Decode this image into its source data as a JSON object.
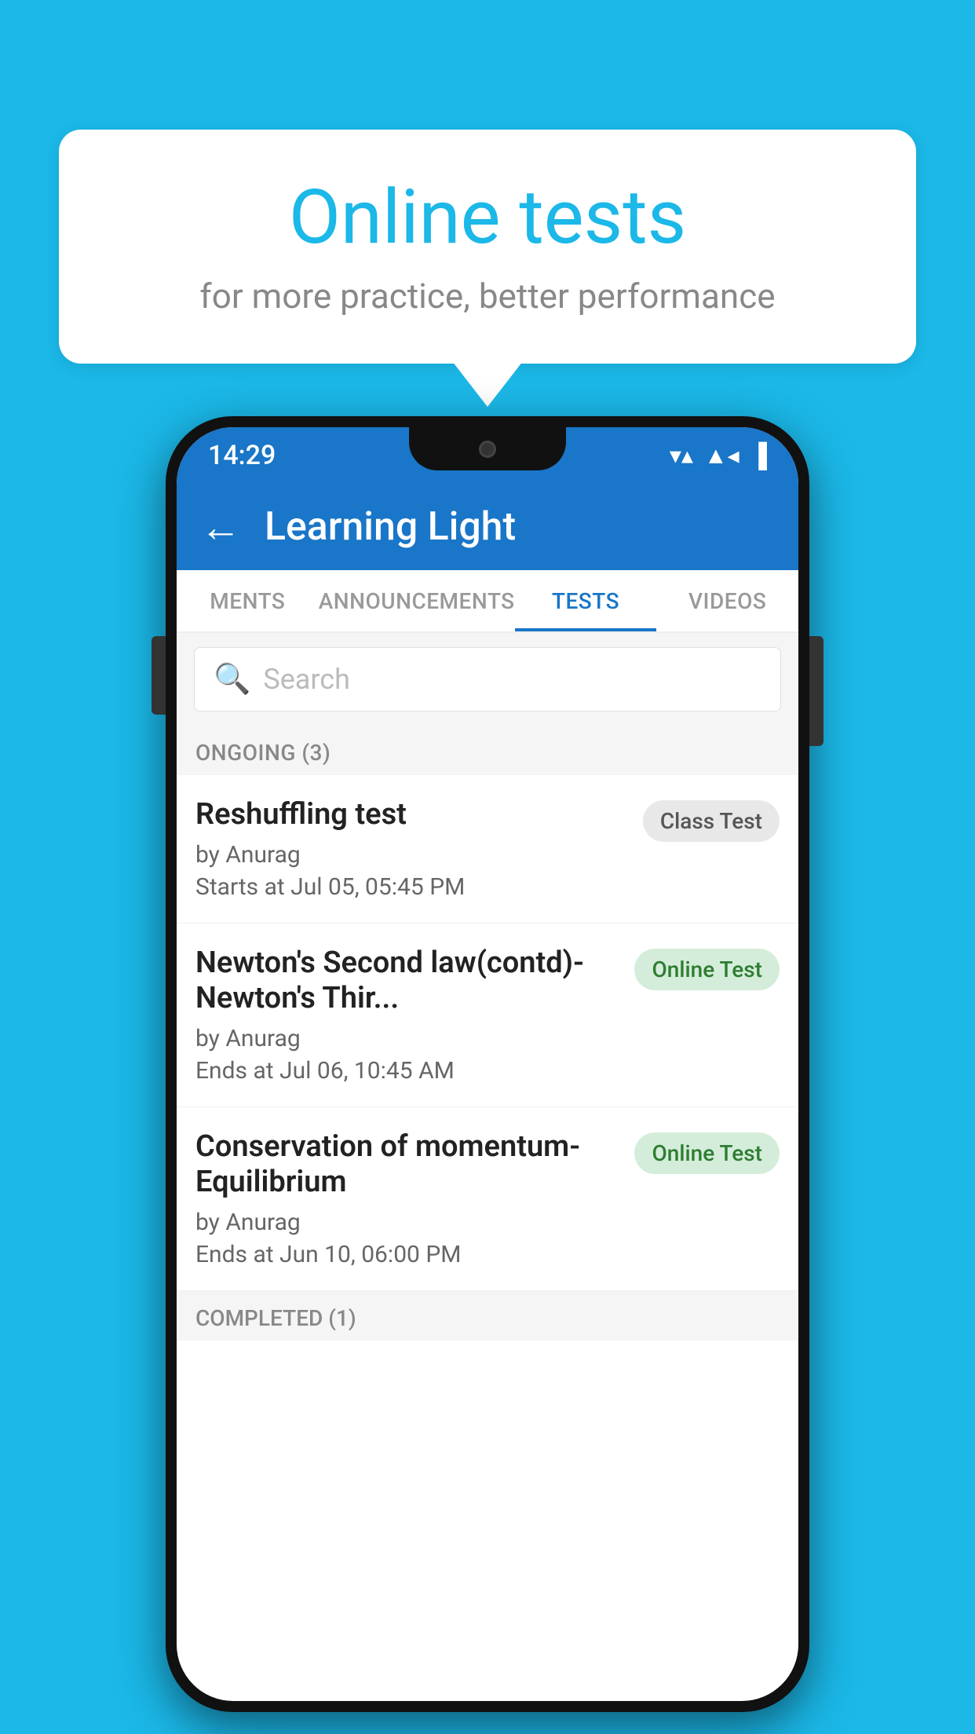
{
  "background_color": "#1BB8E8",
  "speech_bubble": {
    "title": "Online tests",
    "subtitle": "for more practice, better performance"
  },
  "phone": {
    "status_bar": {
      "time": "14:29",
      "wifi": "▼",
      "signal": "▲",
      "battery": "▐"
    },
    "app_bar": {
      "title": "Learning Light",
      "back_label": "←"
    },
    "tabs": [
      {
        "label": "MENTS",
        "active": false
      },
      {
        "label": "ANNOUNCEMENTS",
        "active": false
      },
      {
        "label": "TESTS",
        "active": true
      },
      {
        "label": "VIDEOS",
        "active": false
      }
    ],
    "search": {
      "placeholder": "Search"
    },
    "ongoing_section": {
      "label": "ONGOING (3)"
    },
    "tests": [
      {
        "name": "Reshuffling test",
        "author": "by Anurag",
        "time_label": "Starts at  Jul 05, 05:45 PM",
        "badge": "Class Test",
        "badge_type": "class"
      },
      {
        "name": "Newton's Second law(contd)-Newton's Thir...",
        "author": "by Anurag",
        "time_label": "Ends at  Jul 06, 10:45 AM",
        "badge": "Online Test",
        "badge_type": "online"
      },
      {
        "name": "Conservation of momentum-Equilibrium",
        "author": "by Anurag",
        "time_label": "Ends at  Jun 10, 06:00 PM",
        "badge": "Online Test",
        "badge_type": "online"
      }
    ],
    "completed_section": {
      "label": "COMPLETED (1)"
    }
  }
}
